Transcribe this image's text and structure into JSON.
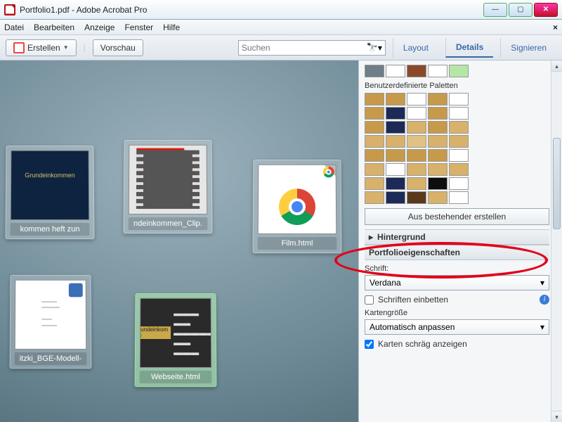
{
  "window": {
    "title": "Portfolio1.pdf - Adobe Acrobat Pro"
  },
  "menu": {
    "items": [
      "Datei",
      "Bearbeiten",
      "Anzeige",
      "Fenster",
      "Hilfe"
    ]
  },
  "toolbar": {
    "create": "Erstellen",
    "preview": "Vorschau",
    "search_placeholder": "Suchen",
    "layout": "Layout",
    "details": "Details",
    "sign": "Signieren"
  },
  "cards": [
    {
      "label": "kommen heft zun"
    },
    {
      "label": "ndeinkommen_Clip."
    },
    {
      "label": "Film.html"
    },
    {
      "label": "itzki_BGE-Modell-"
    },
    {
      "label": "Webseite.html"
    }
  ],
  "panel": {
    "user_palettes": "Benutzerdefinierte Paletten",
    "from_existing": "Aus bestehender erstellen",
    "background": "Hintergrund",
    "portfolio_props": "Portfolioeigenschaften",
    "font_label": "Schrift:",
    "font_value": "Verdana",
    "embed_fonts": "Schriften einbetten",
    "card_size_label": "Kartengröße",
    "card_size_value": "Automatisch anpassen",
    "skew_cards": "Karten schräg anzeigen",
    "palette_top": [
      [
        "#6f7e88",
        "#ffffff",
        "#8a4a2a",
        "#ffffff",
        "#b6e6a6"
      ]
    ],
    "palette_user": [
      [
        "#c79a4a",
        "#c79a4a",
        "#ffffff",
        "#c79a4a",
        "#ffffff"
      ],
      [
        "#c79a4a",
        "#1c2a57",
        "#ffffff",
        "#c79a4a",
        "#ffffff"
      ],
      [
        "#c79a4a",
        "#1c2a57",
        "#d8b26a",
        "#c79a4a",
        "#d8b26a"
      ],
      [
        "#d8b26a",
        "#d8b26a",
        "#e2c184",
        "#d8b26a",
        "#d8b26a"
      ],
      [
        "#c79a4a",
        "#c79a4a",
        "#c79a4a",
        "#c79a4a",
        "#ffffff"
      ],
      [
        "#d8b26a",
        "#ffffff",
        "#d8b26a",
        "#d8b26a",
        "#d8b26a"
      ],
      [
        "#d8b26a",
        "#1c2a57",
        "#d8b26a",
        "#0e0e0e",
        "#ffffff"
      ],
      [
        "#d8b26a",
        "#1c2a57",
        "#5a3a1a",
        "#d8b26a",
        "#ffffff"
      ]
    ]
  }
}
